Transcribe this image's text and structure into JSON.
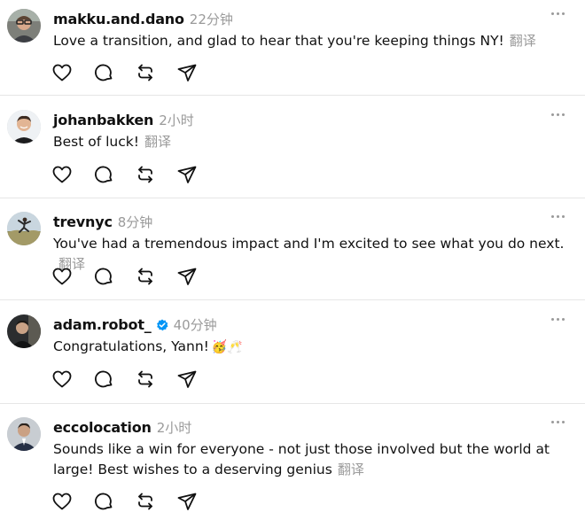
{
  "comments": [
    {
      "username": "makku.and.dano",
      "verified": false,
      "time": "22分钟",
      "text": "Love a transition, and glad to hear that you're keeping things NY!",
      "translate": "翻译",
      "avatar": "avatar-glasses-man"
    },
    {
      "username": "johanbakken",
      "verified": false,
      "time": "2小时",
      "text": "Best of luck!",
      "translate": "翻译",
      "avatar": "avatar-smiling-man"
    },
    {
      "username": "trevnyc",
      "verified": false,
      "time": "8分钟",
      "text": "You've had a tremendous impact and I'm excited to see what you do next.",
      "translate": "翻译",
      "avatar": "avatar-jumping-landscape"
    },
    {
      "username": "adam.robot_",
      "verified": true,
      "time": "40分钟",
      "text": "Congratulations, Yann!",
      "emoji": "🥳🥂",
      "avatar": "avatar-man-dark"
    },
    {
      "username": "eccolocation",
      "verified": false,
      "time": "2小时",
      "text": "Sounds like a win for everyone - not just those involved but the world at large! Best wishes to a deserving genius",
      "translate": "翻译",
      "avatar": "avatar-man-suit"
    }
  ],
  "actions": [
    "like-heart-icon",
    "reply-bubble-icon",
    "repost-arrows-icon",
    "share-send-icon"
  ],
  "colors": {
    "text": "#111111",
    "muted": "#9a9a9a",
    "divider": "#e6e6e6",
    "verified": "#0095f6"
  }
}
